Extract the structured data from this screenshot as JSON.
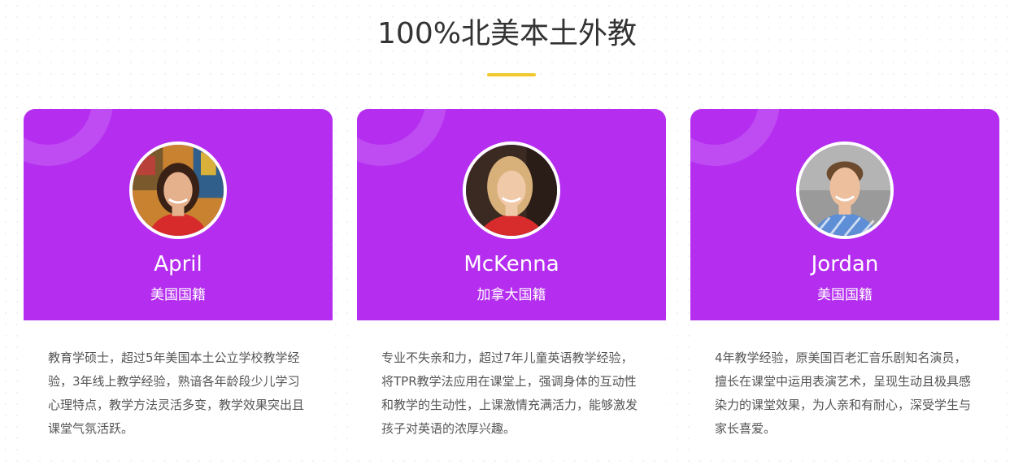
{
  "section": {
    "title": "100%北美本土外教"
  },
  "colors": {
    "card_header": "#b52ef0",
    "accent_underline": "#f2c82c",
    "title_text": "#333333",
    "body_text": "#555555"
  },
  "teachers": [
    {
      "name": "April",
      "nationality": "美国国籍",
      "description": "教育学硕士，超过5年美国本土公立学校教学经验，3年线上教学经验，熟谙各年龄段少儿学习心理特点，教学方法灵活多变，教学效果突出且课堂气氛活跃。"
    },
    {
      "name": "McKenna",
      "nationality": "加拿大国籍",
      "description": "专业不失亲和力，超过7年儿童英语教学经验，将TPR教学法应用在课堂上，强调身体的互动性和教学的生动性，上课激情充满活力，能够激发孩子对英语的浓厚兴趣。"
    },
    {
      "name": "Jordan",
      "nationality": "美国国籍",
      "description": "4年教学经验，原美国百老汇音乐剧知名演员，擅长在课堂中运用表演艺术，呈现生动且极具感染力的课堂效果，为人亲和有耐心，深受学生与家长喜爱。"
    }
  ]
}
